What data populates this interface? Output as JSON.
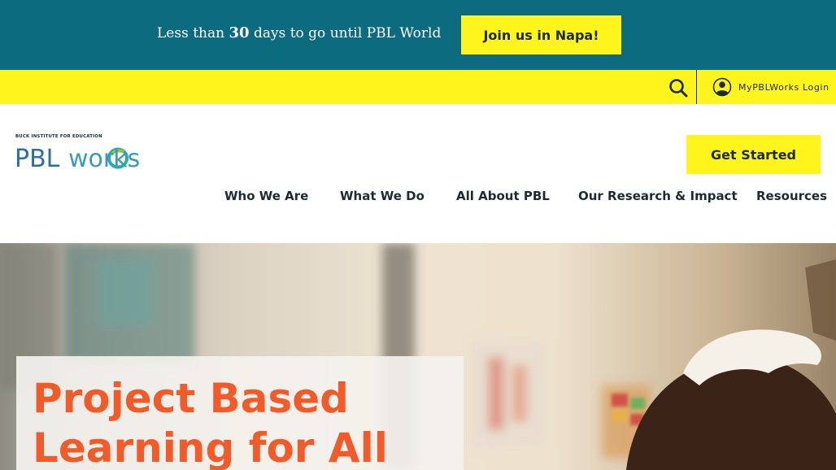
{
  "promo": {
    "prefix": "Less than",
    "days": "30",
    "suffix": "days to go until PBL World",
    "button_label": "Join us in Napa!"
  },
  "utility": {
    "search_icon": "search-icon",
    "login_icon": "user-circle-icon",
    "login_label": "MyPBLWorks Login"
  },
  "logo": {
    "tagline": "BUCK INSTITUTE FOR EDUCATION",
    "part1": "PBL",
    "part2": "works"
  },
  "header": {
    "cta_label": "Get Started"
  },
  "nav": {
    "items": [
      {
        "label": "Who We Are"
      },
      {
        "label": "What We Do"
      },
      {
        "label": "All About PBL"
      },
      {
        "label": "Our Research & Impact"
      },
      {
        "label": "Resources"
      }
    ]
  },
  "hero": {
    "title_line1": "Project Based",
    "title_line2": "Learning for All"
  },
  "colors": {
    "promo_bg": "#0d6b80",
    "accent_yellow": "#fff41c",
    "title_orange": "#f15a29",
    "text_dark": "#1c2b33",
    "logo_blue": "#2a6fa8",
    "logo_green": "#8dc63f"
  }
}
